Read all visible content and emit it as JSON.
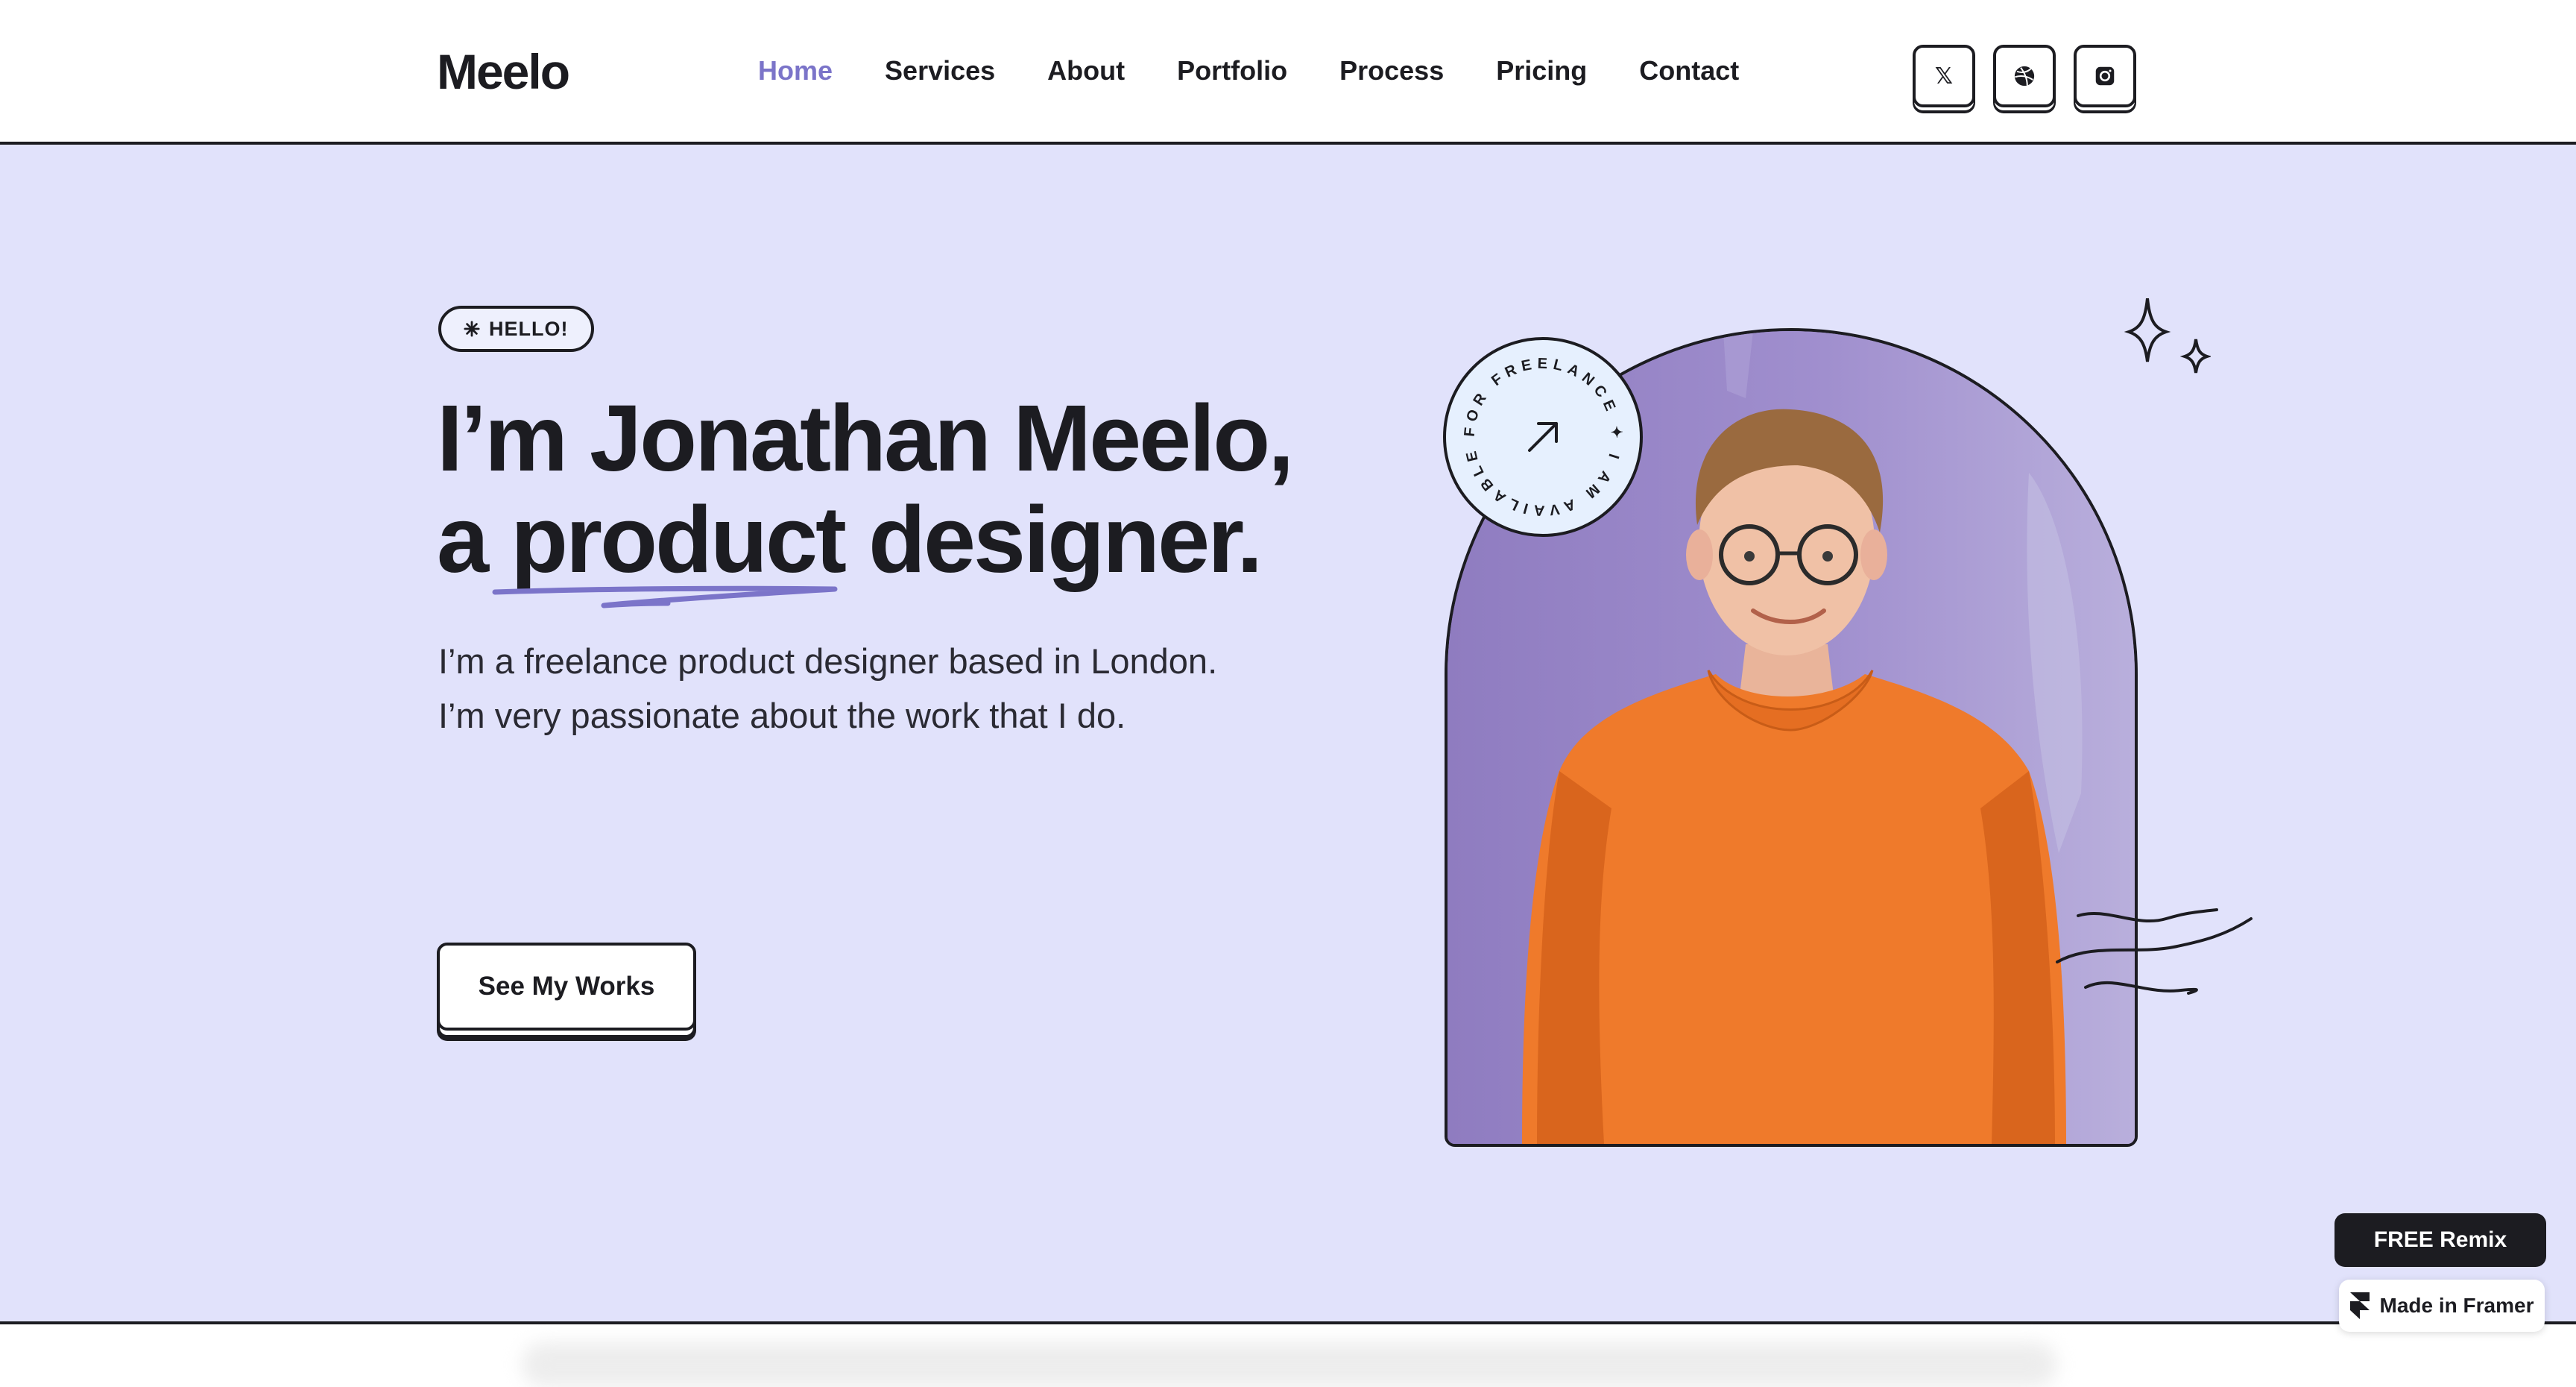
{
  "header": {
    "logo": "Meelo",
    "nav": [
      {
        "label": "Home",
        "active": true
      },
      {
        "label": "Services"
      },
      {
        "label": "About"
      },
      {
        "label": "Portfolio"
      },
      {
        "label": "Process"
      },
      {
        "label": "Pricing"
      },
      {
        "label": "Contact"
      }
    ],
    "socials": [
      {
        "icon": "x-icon",
        "glyph": "𝕏"
      },
      {
        "icon": "dribbble-icon"
      },
      {
        "icon": "instagram-icon"
      }
    ]
  },
  "hero": {
    "pill": "HELLO!",
    "pill_icon": "sparkle-icon",
    "headline_line1": "I’m Jonathan Meelo,",
    "headline_line2": "a product designer.",
    "subtitle_line1": "I’m a freelance product designer based in London.",
    "subtitle_line2": "I’m very passionate about the work that I do.",
    "cta": "See My Works",
    "badge_text": "FOR FREELANCE ✦ I AM AVAILABLE ✦ ",
    "badge_icon": "arrow-up-right-icon"
  },
  "framer": {
    "remix": "FREE Remix",
    "made_in": "Made in Framer"
  },
  "colors": {
    "accent": "#7b74c9",
    "hero_bg": "#e1e2fb",
    "ink": "#1c1c21",
    "sweater": "#ef7a2b",
    "photo_bg": "#9f8ec9"
  }
}
